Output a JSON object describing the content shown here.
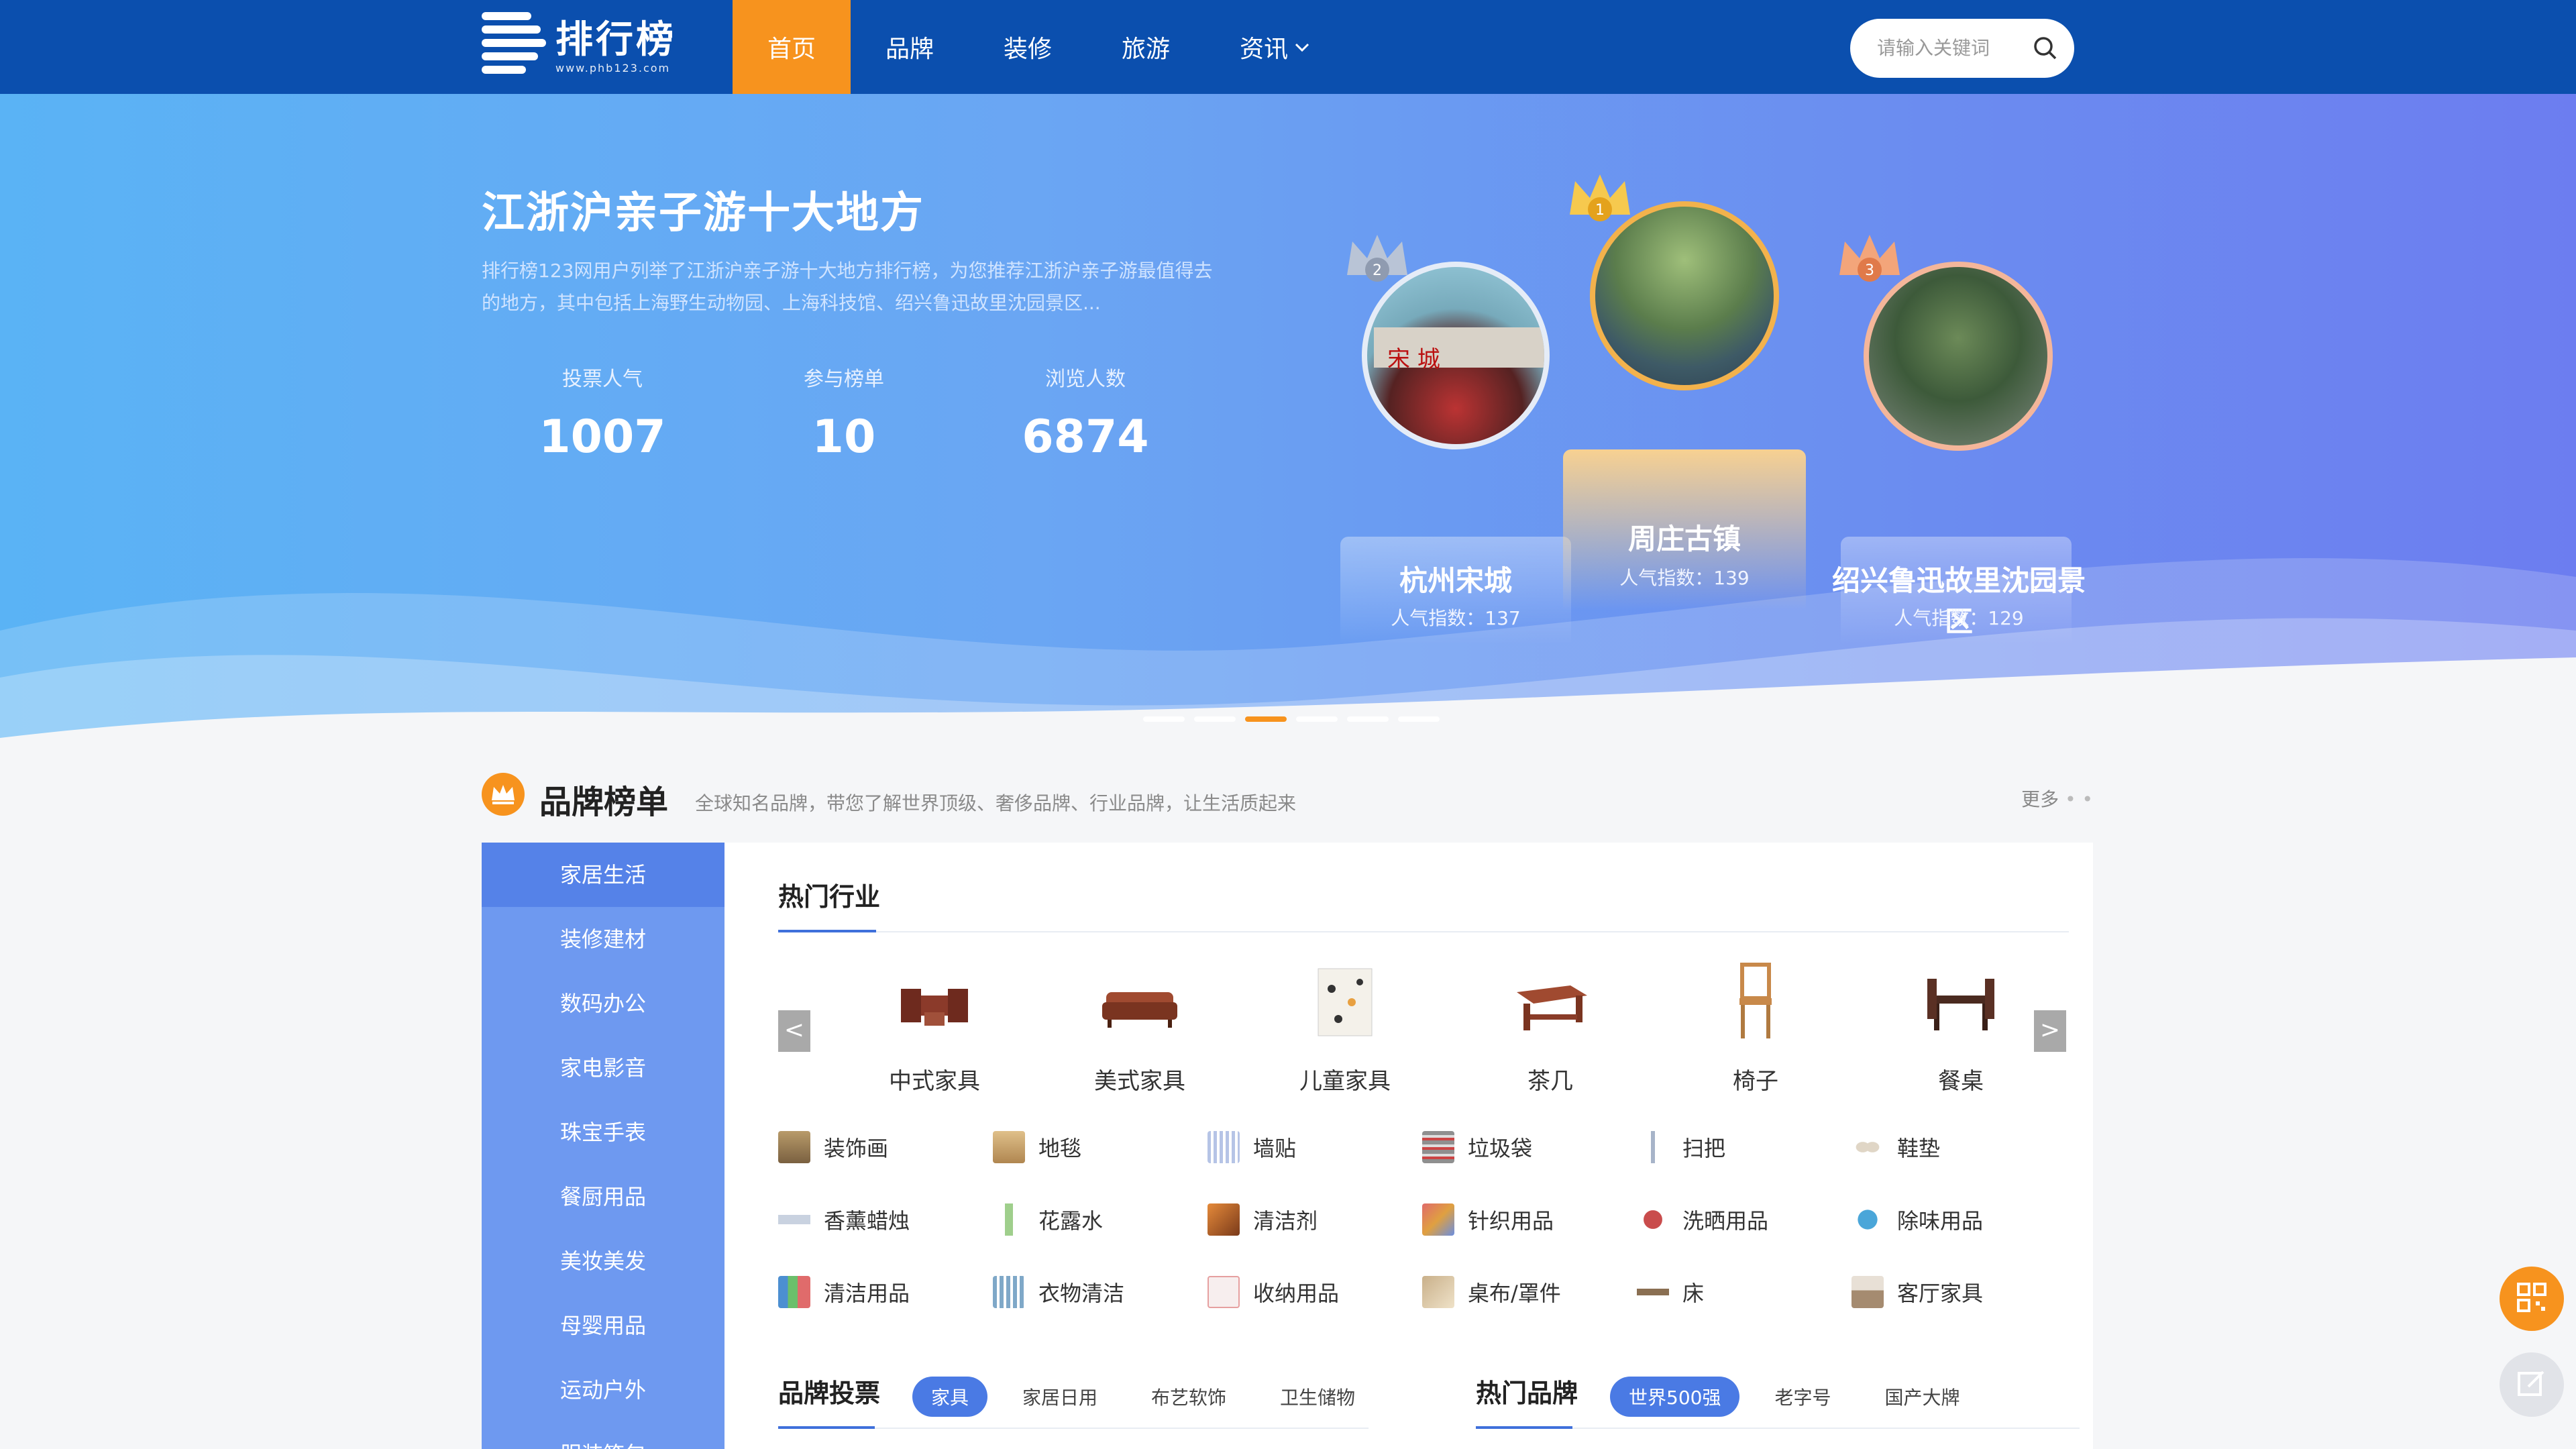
{
  "header": {
    "logo_title": "排行榜",
    "logo_sub": "www.phb123.com",
    "nav": [
      {
        "label": "首页",
        "active": true
      },
      {
        "label": "品牌",
        "active": false
      },
      {
        "label": "装修",
        "active": false
      },
      {
        "label": "旅游",
        "active": false
      },
      {
        "label": "资讯",
        "active": false,
        "has_dropdown": true
      }
    ],
    "search_placeholder": "请输入关键词",
    "colors": {
      "bar": "#0b4fae",
      "accent": "#f7931e"
    }
  },
  "banner": {
    "title": "江浙沪亲子游十大地方",
    "description": "排行榜123网用户列举了江浙沪亲子游十大地方排行榜，为您推荐江浙沪亲子游最值得去的地方，其中包括上海野生动物园、上海科技馆、绍兴鲁迅故里沈园景区...",
    "stats": [
      {
        "label": "投票人气",
        "value": "1007"
      },
      {
        "label": "参与榜单",
        "value": "10"
      },
      {
        "label": "浏览人数",
        "value": "6874"
      }
    ],
    "podium": [
      {
        "rank": "2",
        "name": "杭州宋城",
        "score": "人气指数：137"
      },
      {
        "rank": "1",
        "name": "周庄古镇",
        "score": "人气指数：139"
      },
      {
        "rank": "3",
        "name": "绍兴鲁迅故里沈园景区",
        "score": "人气指数：129"
      }
    ],
    "slides": 6,
    "active_slide": 3
  },
  "brand_section": {
    "title": "品牌榜单",
    "description": "全球知名品牌，带您了解世界顶级、奢侈品牌、行业品牌，让生活质起来",
    "more": "更多",
    "sidebar": [
      "家居生活",
      "装修建材",
      "数码办公",
      "家电影音",
      "珠宝手表",
      "餐厨用品",
      "美妆美发",
      "母婴用品",
      "运动户外",
      "服装箱包"
    ],
    "active_sidebar": 0,
    "tab_title": "热门行业",
    "arrow_prev": "<",
    "arrow_next": ">",
    "carousel": [
      {
        "label": "中式家具",
        "icon": "chinese-furniture-icon"
      },
      {
        "label": "美式家具",
        "icon": "american-sofa-icon"
      },
      {
        "label": "儿童家具",
        "icon": "kids-wardrobe-icon"
      },
      {
        "label": "茶几",
        "icon": "tea-table-icon"
      },
      {
        "label": "椅子",
        "icon": "chair-icon"
      },
      {
        "label": "餐桌",
        "icon": "dining-table-icon"
      }
    ],
    "grid": [
      {
        "label": "装饰画",
        "icon": "painting-icon",
        "color": "#b89b6a"
      },
      {
        "label": "地毯",
        "icon": "carpet-icon",
        "color": "#c8a26b"
      },
      {
        "label": "墙贴",
        "icon": "wall-sticker-icon",
        "color": "#b6c4e6"
      },
      {
        "label": "垃圾袋",
        "icon": "trash-bag-icon",
        "color": "#8f8f8f"
      },
      {
        "label": "扫把",
        "icon": "broom-icon",
        "color": "#a7b4c9"
      },
      {
        "label": "鞋垫",
        "icon": "insole-icon",
        "color": "#e0d6c6"
      },
      {
        "label": "香薰蜡烛",
        "icon": "candle-icon",
        "color": "#c9d2e0"
      },
      {
        "label": "花露水",
        "icon": "toilet-water-icon",
        "color": "#9fcf8c"
      },
      {
        "label": "清洁剂",
        "icon": "detergent-icon",
        "color": "#e58a3a"
      },
      {
        "label": "针织用品",
        "icon": "knitting-icon",
        "color": "#e06b6b"
      },
      {
        "label": "洗晒用品",
        "icon": "laundry-icon",
        "color": "#c94c4c"
      },
      {
        "label": "除味用品",
        "icon": "deodorant-icon",
        "color": "#4aa6d9"
      },
      {
        "label": "清洁用品",
        "icon": "cleaning-icon",
        "color": "#4c8fd1"
      },
      {
        "label": "衣物清洁",
        "icon": "clothes-wash-icon",
        "color": "#7fa8c8"
      },
      {
        "label": "收纳用品",
        "icon": "storage-icon",
        "color": "#e6a0a0"
      },
      {
        "label": "桌布/罩件",
        "icon": "tablecloth-icon",
        "color": "#c9b08a"
      },
      {
        "label": "床",
        "icon": "bed-icon",
        "color": "#8a6f52"
      },
      {
        "label": "客厅家具",
        "icon": "living-room-icon",
        "color": "#a58b70"
      }
    ],
    "vote": {
      "title": "品牌投票",
      "chips": [
        "家具",
        "家居日用",
        "布艺软饰",
        "卫生储物"
      ],
      "active": 0
    },
    "hot_brands": {
      "title": "热门品牌",
      "chips": [
        "世界500强",
        "老字号",
        "国产大牌"
      ],
      "active": 0
    }
  },
  "floating": [
    {
      "icon": "qr-code-icon",
      "color": "#f7931e"
    },
    {
      "icon": "edit-icon",
      "color": "#e1e3e8"
    }
  ]
}
